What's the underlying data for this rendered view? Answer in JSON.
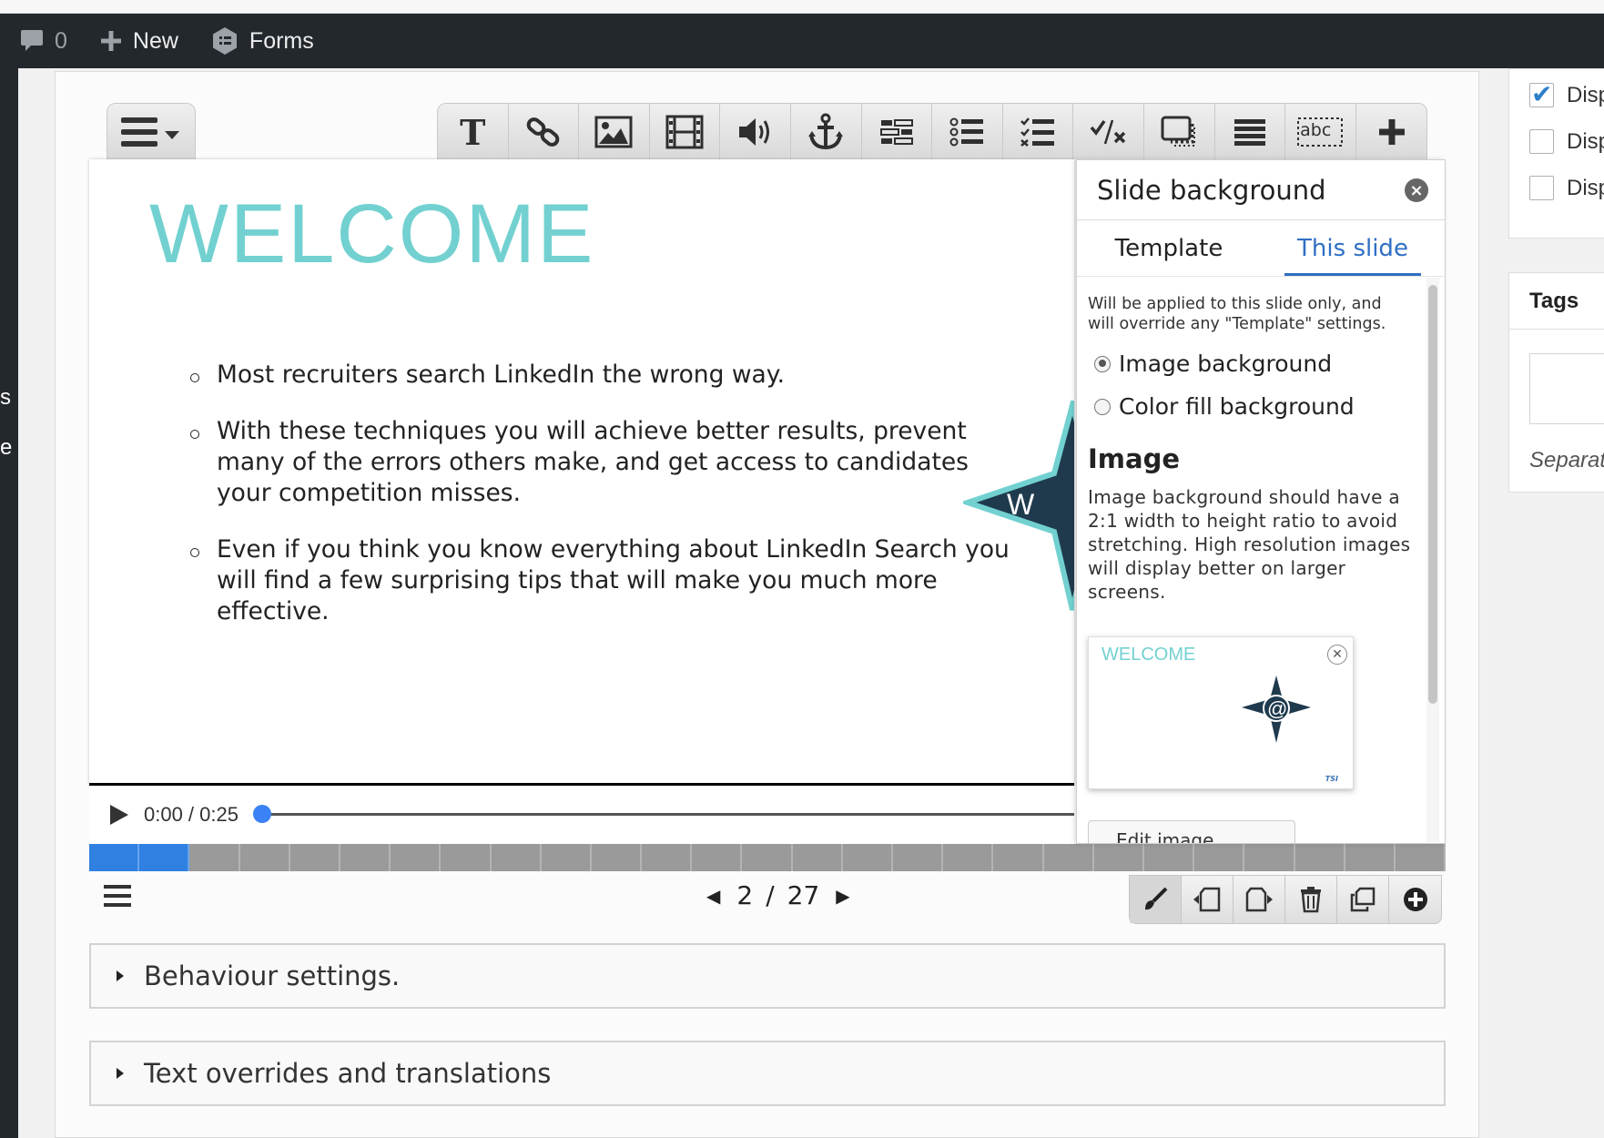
{
  "adminbar": {
    "comments_count": "0",
    "new_label": "New",
    "forms_label": "Forms"
  },
  "left_fragments": [
    "s",
    "e"
  ],
  "toolbar": {
    "text_tool_glyph": "T",
    "tools": [
      "text",
      "link",
      "image",
      "video",
      "audio",
      "anchor",
      "table",
      "list",
      "checklist",
      "true-false",
      "dialog-card",
      "summary",
      "fill-in-blanks",
      "add"
    ],
    "fill_in_blanks_label": "abc"
  },
  "slide": {
    "title": "WELCOME",
    "bullets": [
      "Most recruiters search LinkedIn the wrong way.",
      "With these techniques you will achieve better results, prevent many of the errors others make, and get access to candidates your competition misses.",
      "Even if you think you know everything about LinkedIn Search you will find a few surprising tips that will make you much more effective."
    ],
    "compass_letter": "W"
  },
  "player": {
    "time": "0:00 / 0:25",
    "progress": 0
  },
  "progress_bar": {
    "total_slides": 27,
    "completed_segments": 2
  },
  "pager": {
    "current": "2",
    "separator": "/",
    "total": "27"
  },
  "accordions": [
    "Behaviour settings.",
    "Text overrides and translations"
  ],
  "slide_background": {
    "title": "Slide background",
    "tabs": [
      "Template",
      "This slide"
    ],
    "active_tab": "This slide",
    "note": "Will be applied to this slide only, and will override any \"Template\" settings.",
    "options": [
      "Image background",
      "Color fill background"
    ],
    "selected_option": "Image background",
    "image_heading": "Image",
    "image_desc": "Image background should have a 2:1 width to height ratio to avoid stretching. High resolution images will display better on larger screens.",
    "thumb_title": "WELCOME",
    "thumb_brand": "TSI",
    "edit_label": "Edit image"
  },
  "sidebar": {
    "checkboxes": [
      {
        "label": "Disp",
        "checked": true
      },
      {
        "label": "Disp",
        "checked": false
      },
      {
        "label": "Disp",
        "checked": false
      }
    ],
    "tags_title": "Tags",
    "tags_hint": "Separat"
  },
  "colors": {
    "accent_blue": "#2f6fc4",
    "title_teal": "#72d1d0",
    "admin_bar": "#23282d",
    "progress_done": "#2f80e0"
  }
}
